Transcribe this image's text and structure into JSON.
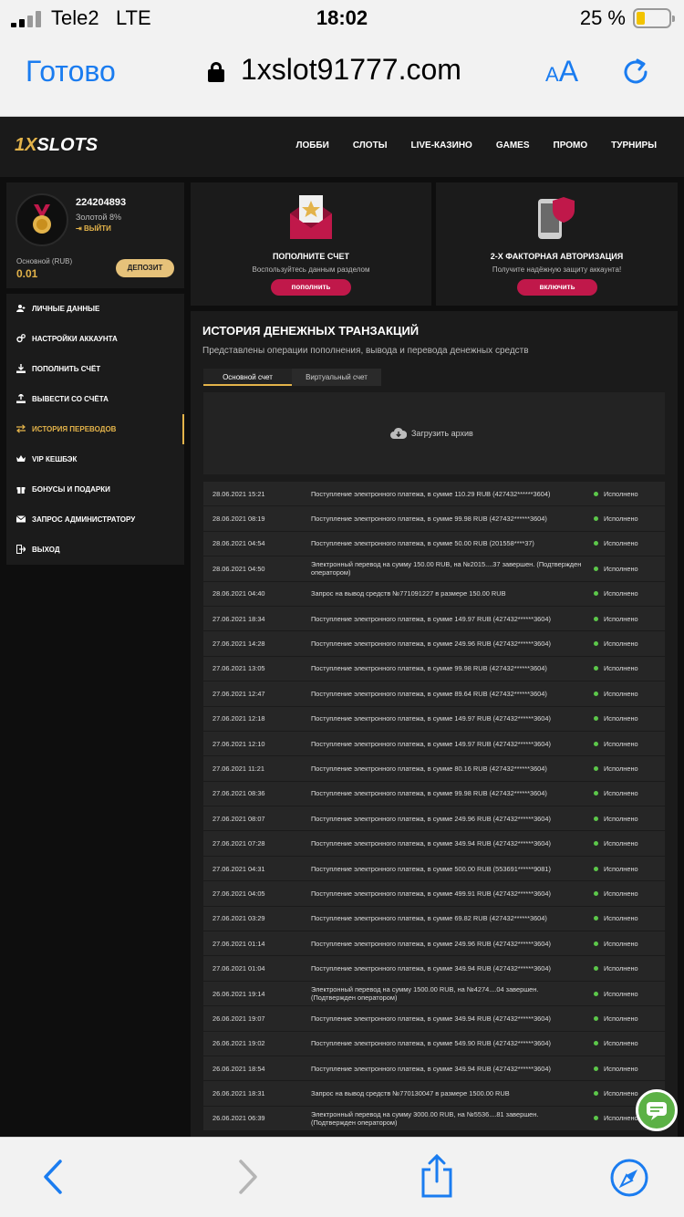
{
  "status_bar": {
    "carrier": "Tele2",
    "network": "LTE",
    "time": "18:02",
    "battery_text": "25 %"
  },
  "browser": {
    "done_label": "Готово",
    "url": "1xslot91777.com",
    "text_size_small": "A",
    "text_size_big": "A"
  },
  "site": {
    "logo_one": "1X",
    "logo_rest": "SLOTS",
    "nav": [
      "ЛОББИ",
      "СЛОТЫ",
      "LIVE-КАЗИНО",
      "GAMES",
      "ПРОМО",
      "ТУРНИРЫ"
    ]
  },
  "profile": {
    "user_id": "224204893",
    "tier": "Золотой 8%",
    "logout_label": "ВЫЙТИ",
    "balance_label": "Основной (RUB)",
    "balance_value": "0.01",
    "deposit_label": "ДЕПОЗИТ"
  },
  "menu": [
    {
      "label": "ЛИЧНЫЕ ДАННЫЕ",
      "icon": "user-add-icon"
    },
    {
      "label": "НАСТРОЙКИ АККАУНТА",
      "icon": "gears-icon"
    },
    {
      "label": "ПОПОЛНИТЬ СЧЁТ",
      "icon": "download-icon"
    },
    {
      "label": "ВЫВЕСТИ СО СЧЁТА",
      "icon": "upload-icon"
    },
    {
      "label": "ИСТОРИЯ ПЕРЕВОДОВ",
      "icon": "transfer-icon"
    },
    {
      "label": "VIP КЕШБЭК",
      "icon": "crown-icon"
    },
    {
      "label": "БОНУСЫ И ПОДАРКИ",
      "icon": "gift-icon"
    },
    {
      "label": "ЗАПРОС АДМИНИСТРАТОРУ",
      "icon": "mail-icon"
    },
    {
      "label": "ВЫХОД",
      "icon": "exit-icon"
    }
  ],
  "promo_cards": [
    {
      "title": "ПОПОЛНИТЕ СЧЕТ",
      "subtitle": "Воспользуйтесь данным разделом",
      "button": "пополнить",
      "icon": "envelope-star-icon"
    },
    {
      "title": "2-Х ФАКТОРНАЯ АВТОРИЗАЦИЯ",
      "subtitle": "Получите надёжную защиту аккаунта!",
      "button": "включить",
      "icon": "phone-shield-icon"
    }
  ],
  "history": {
    "title": "ИСТОРИЯ ДЕНЕЖНЫХ ТРАНЗАКЦИЙ",
    "description": "Представлены операции пополнения, вывода и перевода денежных средств",
    "tabs": [
      "Основной счет",
      "Виртуальный счет"
    ],
    "archive_label": "Загрузить архив",
    "rows": [
      {
        "date": "28.06.2021 15:21",
        "desc": "Поступление электронного платежа, в сумме 110.29 RUB (427432******3604)",
        "status": "Исполнено"
      },
      {
        "date": "28.06.2021 08:19",
        "desc": "Поступление электронного платежа, в сумме 99.98 RUB (427432******3604)",
        "status": "Исполнено"
      },
      {
        "date": "28.06.2021 04:54",
        "desc": "Поступление электронного платежа, в сумме 50.00 RUB (201558****37)",
        "status": "Исполнено"
      },
      {
        "date": "28.06.2021 04:50",
        "desc": "Электронный перевод на сумму 150.00 RUB, на №2015....37 завершен. (Подтвержден оператором)",
        "status": "Исполнено"
      },
      {
        "date": "28.06.2021 04:40",
        "desc": "Запрос на вывод средств №771091227 в размере 150.00 RUB",
        "status": "Исполнено"
      },
      {
        "date": "27.06.2021 18:34",
        "desc": "Поступление электронного платежа, в сумме 149.97 RUB (427432******3604)",
        "status": "Исполнено"
      },
      {
        "date": "27.06.2021 14:28",
        "desc": "Поступление электронного платежа, в сумме 249.96 RUB (427432******3604)",
        "status": "Исполнено"
      },
      {
        "date": "27.06.2021 13:05",
        "desc": "Поступление электронного платежа, в сумме 99.98 RUB (427432******3604)",
        "status": "Исполнено"
      },
      {
        "date": "27.06.2021 12:47",
        "desc": "Поступление электронного платежа, в сумме 89.64 RUB (427432******3604)",
        "status": "Исполнено"
      },
      {
        "date": "27.06.2021 12:18",
        "desc": "Поступление электронного платежа, в сумме 149.97 RUB (427432******3604)",
        "status": "Исполнено"
      },
      {
        "date": "27.06.2021 12:10",
        "desc": "Поступление электронного платежа, в сумме 149.97 RUB (427432******3604)",
        "status": "Исполнено"
      },
      {
        "date": "27.06.2021 11:21",
        "desc": "Поступление электронного платежа, в сумме 80.16 RUB (427432******3604)",
        "status": "Исполнено"
      },
      {
        "date": "27.06.2021 08:36",
        "desc": "Поступление электронного платежа, в сумме 99.98 RUB (427432******3604)",
        "status": "Исполнено"
      },
      {
        "date": "27.06.2021 08:07",
        "desc": "Поступление электронного платежа, в сумме 249.96 RUB (427432******3604)",
        "status": "Исполнено"
      },
      {
        "date": "27.06.2021 07:28",
        "desc": "Поступление электронного платежа, в сумме 349.94 RUB (427432******3604)",
        "status": "Исполнено"
      },
      {
        "date": "27.06.2021 04:31",
        "desc": "Поступление электронного платежа, в сумме 500.00 RUB (553691******9081)",
        "status": "Исполнено"
      },
      {
        "date": "27.06.2021 04:05",
        "desc": "Поступление электронного платежа, в сумме 499.91 RUB (427432******3604)",
        "status": "Исполнено"
      },
      {
        "date": "27.06.2021 03:29",
        "desc": "Поступление электронного платежа, в сумме 69.82 RUB (427432******3604)",
        "status": "Исполнено"
      },
      {
        "date": "27.06.2021 01:14",
        "desc": "Поступление электронного платежа, в сумме 249.96 RUB (427432******3604)",
        "status": "Исполнено"
      },
      {
        "date": "27.06.2021 01:04",
        "desc": "Поступление электронного платежа, в сумме 349.94 RUB (427432******3604)",
        "status": "Исполнено"
      },
      {
        "date": "26.06.2021 19:14",
        "desc": "Электронный перевод на сумму 1500.00 RUB, на №4274....04 завершен. (Подтвержден оператором)",
        "status": "Исполнено"
      },
      {
        "date": "26.06.2021 19:07",
        "desc": "Поступление электронного платежа, в сумме 349.94 RUB (427432******3604)",
        "status": "Исполнено"
      },
      {
        "date": "26.06.2021 19:02",
        "desc": "Поступление электронного платежа, в сумме 549.90 RUB (427432******3604)",
        "status": "Исполнено"
      },
      {
        "date": "26.06.2021 18:54",
        "desc": "Поступление электронного платежа, в сумме 349.94 RUB (427432******3604)",
        "status": "Исполнено"
      },
      {
        "date": "26.06.2021 18:31",
        "desc": "Запрос на вывод средств №770130047 в размере 1500.00 RUB",
        "status": "Исполнено"
      },
      {
        "date": "26.06.2021 06:39",
        "desc": "Электронный перевод на сумму 3000.00 RUB, на №5536....81 завершен. (Подтвержден оператором)",
        "status": "Исполнено"
      }
    ]
  },
  "colors": {
    "accent_gold": "#e3b34a",
    "accent_red": "#c0184a",
    "status_green": "#5cc84a",
    "ios_blue": "#1a7cf0"
  },
  "toolbar_icons": [
    "back-icon",
    "forward-icon",
    "share-icon",
    "compass-icon"
  ]
}
